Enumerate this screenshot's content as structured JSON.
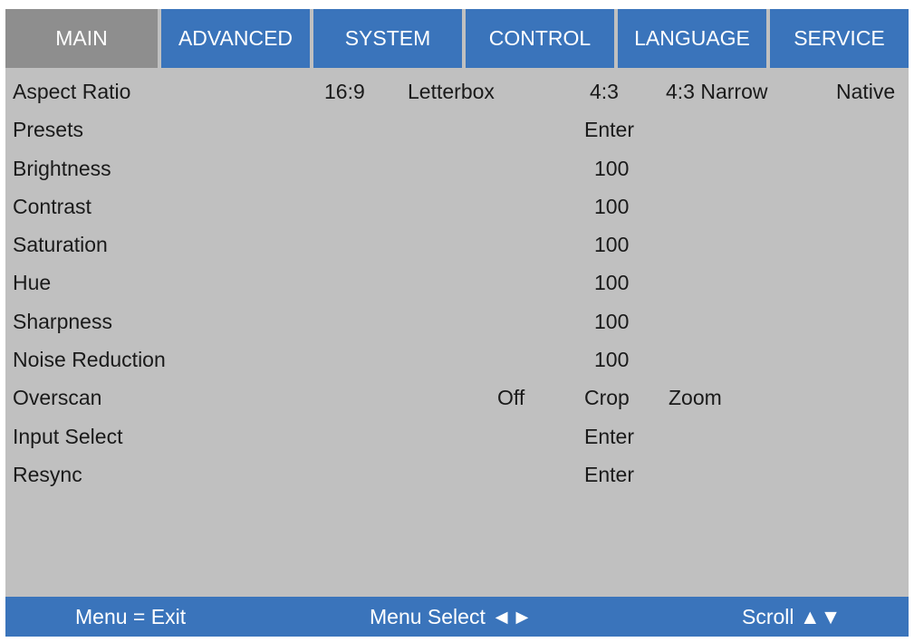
{
  "tabs": [
    {
      "label": "MAIN",
      "active": true
    },
    {
      "label": "ADVANCED"
    },
    {
      "label": "SYSTEM"
    },
    {
      "label": "CONTROL"
    },
    {
      "label": "LANGUAGE"
    },
    {
      "label": "SERVICE"
    }
  ],
  "rows": {
    "aspect_ratio": {
      "label": "Aspect Ratio",
      "options": [
        "16:9",
        "Letterbox",
        "4:3",
        "4:3 Narrow",
        "Native"
      ]
    },
    "presets": {
      "label": "Presets",
      "value": "Enter"
    },
    "brightness": {
      "label": "Brightness",
      "value": "100"
    },
    "contrast": {
      "label": "Contrast",
      "value": "100"
    },
    "saturation": {
      "label": "Saturation",
      "value": "100"
    },
    "hue": {
      "label": "Hue",
      "value": "100"
    },
    "sharpness": {
      "label": "Sharpness",
      "value": "100"
    },
    "noise_reduction": {
      "label": "Noise Reduction",
      "value": "100"
    },
    "overscan": {
      "label": "Overscan",
      "options": [
        "Off",
        "Crop",
        "Zoom"
      ]
    },
    "input_select": {
      "label": "Input Select",
      "value": "Enter"
    },
    "resync": {
      "label": "Resync",
      "value": "Enter"
    }
  },
  "footer": {
    "exit": "Menu = Exit",
    "select": "Menu Select  ◄►",
    "scroll": "Scroll  ▲▼"
  },
  "colors": {
    "tab_bg": "#3a74bb",
    "tab_active_bg": "#8e8e8e",
    "panel_bg": "#c0c0c0"
  }
}
